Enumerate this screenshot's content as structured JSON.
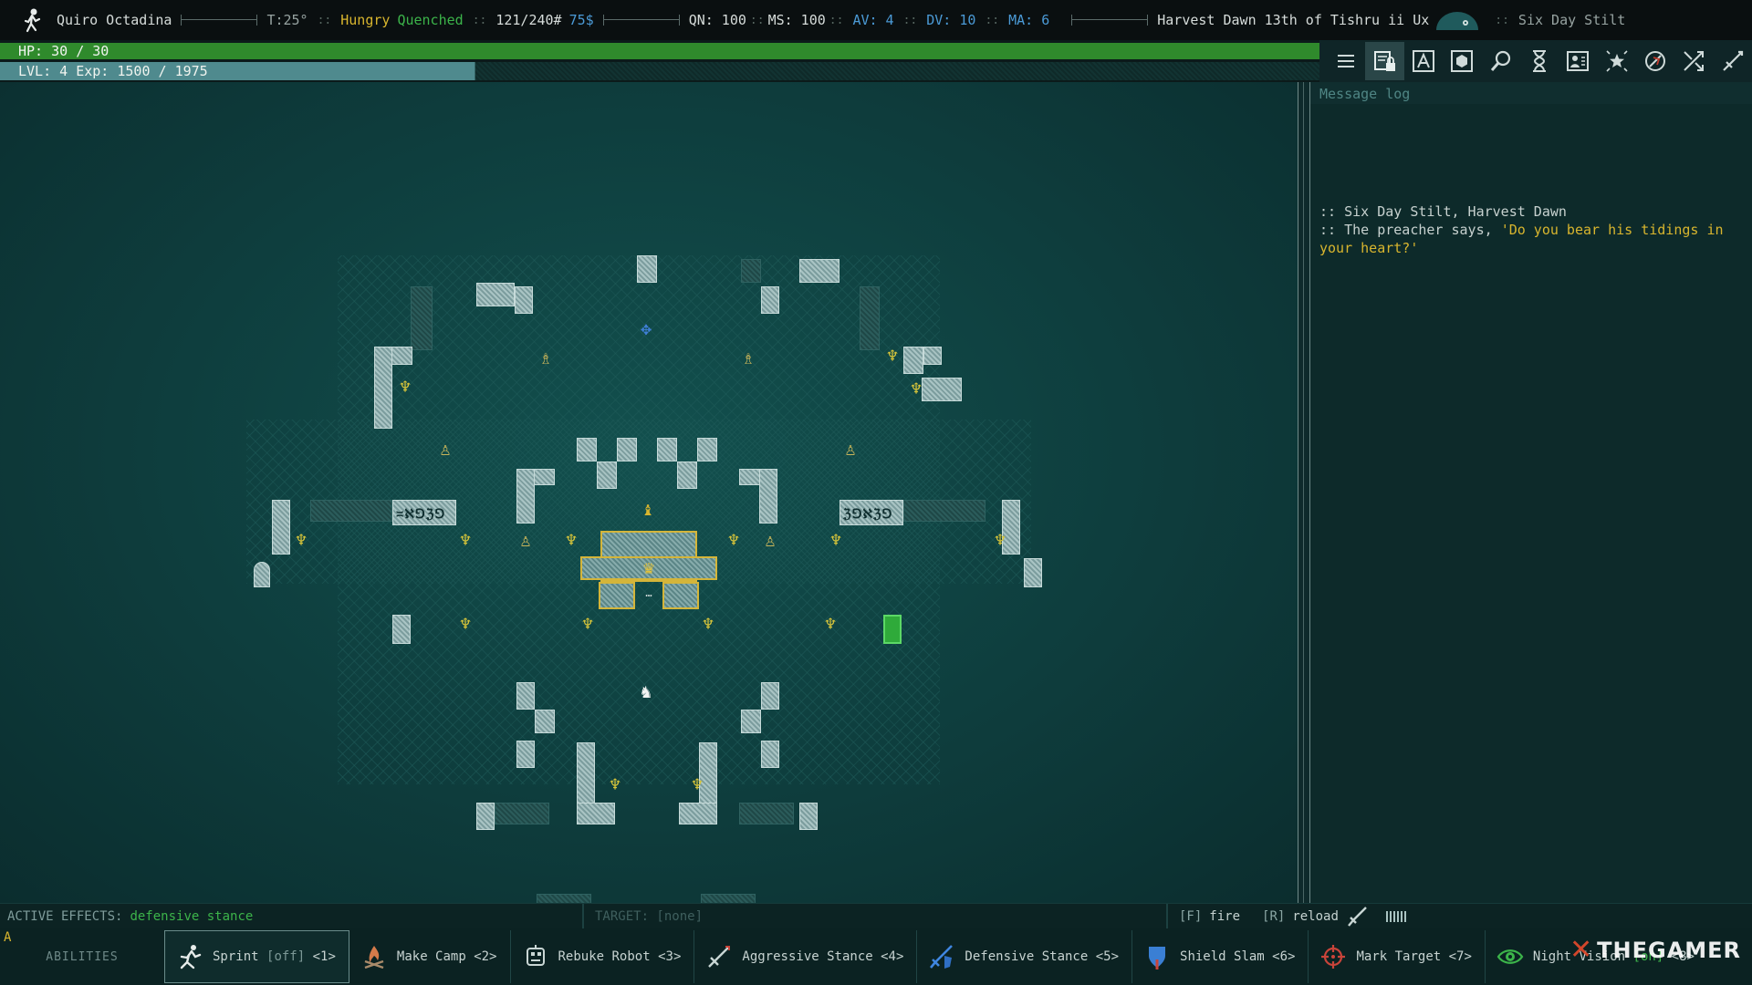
{
  "topbar": {
    "player_name": "Quiro Octadina",
    "temperature": "T:25°",
    "hunger": "Hungry",
    "thirst": "Quenched",
    "weight": "121/240#",
    "money": "75$",
    "stats": [
      {
        "label": "QN: 100",
        "color": "white"
      },
      {
        "label": "MS: 100",
        "color": "white"
      },
      {
        "label": "AV: 4",
        "color": "blue"
      },
      {
        "label": "DV: 10",
        "color": "blue"
      },
      {
        "label": "MA: 6",
        "color": "blue"
      }
    ],
    "date": "Harvest Dawn 13th of Tishru ii Ux",
    "location": "Six Day Stilt",
    "separator": "::"
  },
  "hp": {
    "label": "HP: 30 / 30",
    "current": 30,
    "max": 30
  },
  "xp": {
    "label": "LVL: 4 Exp: 1500 / 1975",
    "level": 4,
    "current": 1500,
    "max": 1975,
    "bar_fraction": 0.36
  },
  "toolbar": {
    "buttons": [
      {
        "name": "menu",
        "icon": "hamburger-icon"
      },
      {
        "name": "character",
        "icon": "locked-page-icon",
        "active": true
      },
      {
        "name": "abilities",
        "icon": "triangle-a-icon"
      },
      {
        "name": "inventory",
        "icon": "hexagon-icon"
      },
      {
        "name": "look",
        "icon": "magnifier-icon"
      },
      {
        "name": "wait",
        "icon": "hourglass-icon"
      },
      {
        "name": "journal",
        "icon": "portrait-icon"
      },
      {
        "name": "factions",
        "icon": "star-icon"
      },
      {
        "name": "quests",
        "icon": "compass-icon"
      },
      {
        "name": "auto-explore",
        "icon": "crossing-arrows-icon"
      },
      {
        "name": "attack",
        "icon": "sword-icon"
      }
    ]
  },
  "message_log": {
    "title": "Message log",
    "messages": [
      {
        "prefix": ":: ",
        "text": "Six Day Stilt, Harvest Dawn",
        "quote": ""
      },
      {
        "prefix": ":: ",
        "text": "The preacher says, ",
        "quote": "'Do you bear his tidings in your heart?'"
      }
    ]
  },
  "statusline": {
    "active_effects_label": "ACTIVE EFFECTS:",
    "active_effects_value": "defensive stance",
    "target": "TARGET: [none]",
    "fire_key": "[F]",
    "fire_label": "fire",
    "reload_key": "[R]",
    "reload_label": "reload",
    "ammo_ticks": 6
  },
  "abilities": {
    "hotkey": "A",
    "label": "ABILITIES",
    "items": [
      {
        "name": "Sprint",
        "tag": "[off]",
        "tag_state": "off",
        "key": "<1>",
        "icon": "running-figure-icon",
        "selected": true
      },
      {
        "name": "Make Camp",
        "tag": "",
        "key": "<2>",
        "icon": "campfire-icon"
      },
      {
        "name": "Rebuke Robot",
        "tag": "",
        "key": "<3>",
        "icon": "robot-fist-icon"
      },
      {
        "name": "Aggressive Stance",
        "tag": "",
        "key": "<4>",
        "icon": "sword-icon"
      },
      {
        "name": "Defensive Stance",
        "tag": "",
        "key": "<5>",
        "icon": "sword-shield-icon"
      },
      {
        "name": "Shield Slam",
        "tag": "",
        "key": "<6>",
        "icon": "shield-icon"
      },
      {
        "name": "Mark Target",
        "tag": "",
        "key": "<7>",
        "icon": "crosshair-icon"
      },
      {
        "name": "Night Vision",
        "tag": "[on]",
        "tag_state": "on",
        "key": "<8>",
        "icon": "eye-icon"
      }
    ]
  },
  "watermark": {
    "text": "THEGAMER"
  },
  "colors": {
    "hp_bar": "#2f8a2c",
    "xp_bar": "#4f8a8e",
    "accent_yellow": "#d8b52e",
    "accent_green": "#3cb44a",
    "accent_blue": "#4b9ad6",
    "map_bg": "#0e3d3d"
  }
}
